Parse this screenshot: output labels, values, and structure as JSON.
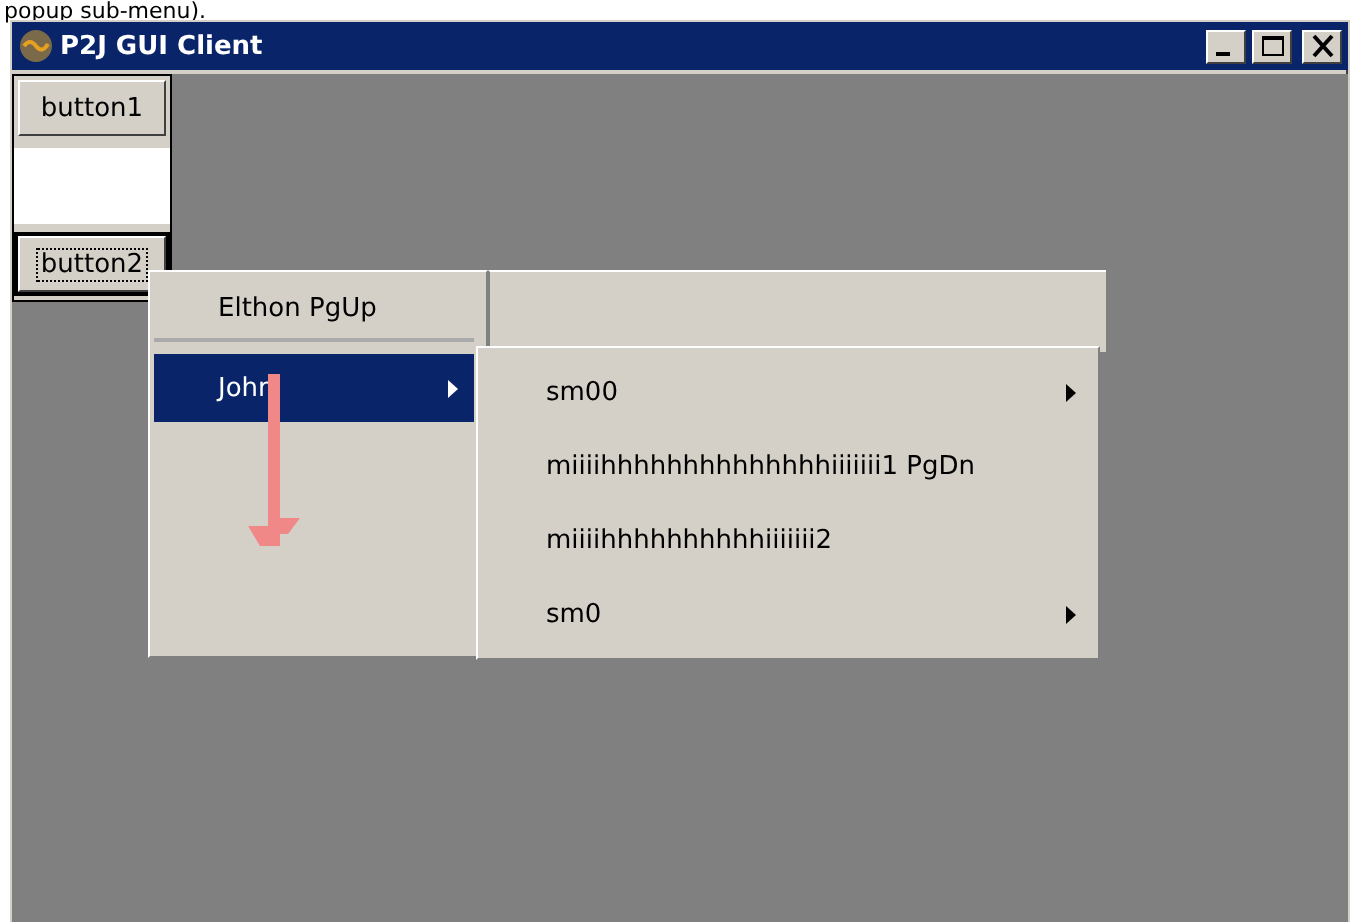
{
  "caption": "popup sub-menu).",
  "window": {
    "title": "P2J GUI Client"
  },
  "form": {
    "buttons": [
      {
        "label": "button1",
        "focused": false
      },
      {
        "label": "button2",
        "focused": true
      }
    ]
  },
  "popup_menu": {
    "items": [
      {
        "label": "Elthon PgUp",
        "selected": false,
        "submenu": false
      },
      {
        "label": "John",
        "selected": true,
        "submenu": true
      }
    ]
  },
  "submenu": {
    "items": [
      {
        "label": "sm00",
        "submenu": true
      },
      {
        "label": "miiiihhhhhhhhhhhhhhiiiiiii1  PgDn",
        "submenu": false
      },
      {
        "label": "miiiihhhhhhhhhhiiiiiii2",
        "submenu": false
      },
      {
        "label": "sm0",
        "submenu": true
      }
    ]
  }
}
